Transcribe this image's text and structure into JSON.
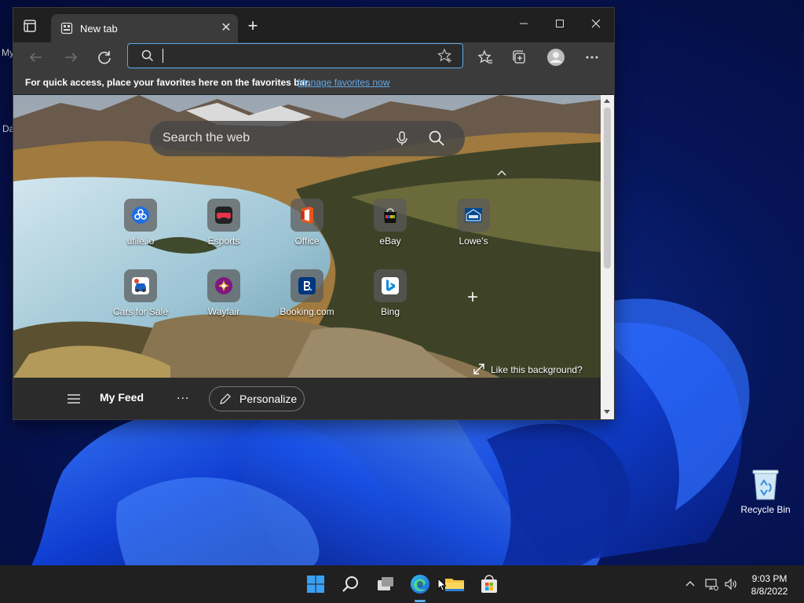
{
  "desktop": {
    "left_fragments": [
      "My",
      "Da"
    ],
    "recycle_bin_label": "Recycle Bin"
  },
  "browser": {
    "tab": {
      "title": "New tab",
      "close_icon": "close-icon"
    },
    "address_bar": {
      "value": "",
      "placeholder": ""
    },
    "favorites_bar": {
      "message": "For quick access, place your favorites here on the favorites bar.",
      "link": "Manage favorites now"
    },
    "new_tab_page": {
      "search_placeholder": "Search the web",
      "quick_links": [
        {
          "label": "ufile.io",
          "icon": "ufile-icon"
        },
        {
          "label": "Esports",
          "icon": "esports-icon"
        },
        {
          "label": "Office",
          "icon": "office-icon"
        },
        {
          "label": "eBay",
          "icon": "ebay-icon"
        },
        {
          "label": "Lowe's",
          "icon": "lowes-icon"
        },
        {
          "label": "Cars for Sale",
          "icon": "cars-icon"
        },
        {
          "label": "Wayfair",
          "icon": "wayfair-icon"
        },
        {
          "label": "Booking.com",
          "icon": "booking-icon"
        },
        {
          "label": "Bing",
          "icon": "bing-icon"
        }
      ],
      "like_background": "Like this background?",
      "feed": {
        "title": "My Feed",
        "more": "...",
        "personalize": "Personalize"
      }
    }
  },
  "taskbar": {
    "time": "9:03 PM",
    "date": "8/8/2022"
  },
  "colors": {
    "accent": "#5fa9e5",
    "browser_dark": "#202020",
    "toolbar": "#3b3b3b"
  }
}
